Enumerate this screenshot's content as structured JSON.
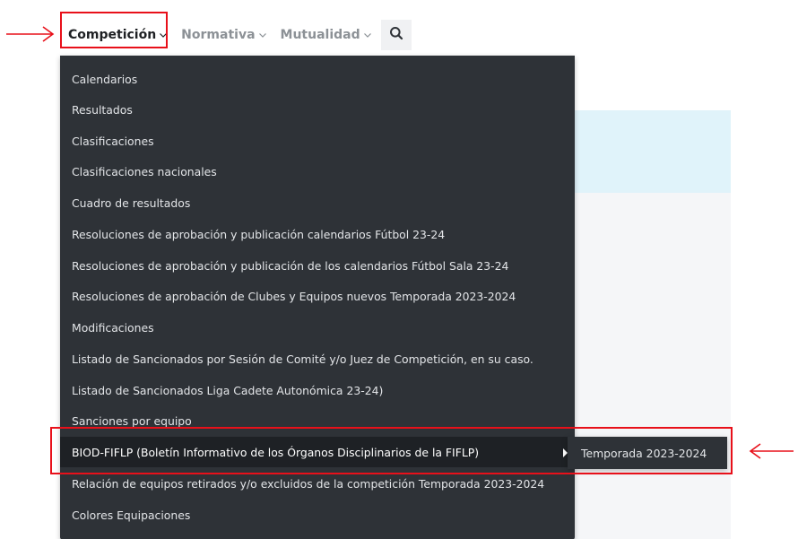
{
  "nav": {
    "items": [
      {
        "label": "Competición",
        "active": true
      },
      {
        "label": "Normativa",
        "active": false
      },
      {
        "label": "Mutualidad",
        "active": false
      }
    ],
    "search_icon": "search-icon"
  },
  "dropdown": {
    "items": [
      {
        "label": "Calendarios"
      },
      {
        "label": "Resultados"
      },
      {
        "label": "Clasificaciones"
      },
      {
        "label": "Clasificaciones nacionales"
      },
      {
        "label": "Cuadro de resultados"
      },
      {
        "label": "Resoluciones de aprobación y publicación calendarios Fútbol 23-24"
      },
      {
        "label": "Resoluciones de aprobación y publicación de los calendarios Fútbol Sala 23-24"
      },
      {
        "label": "Resoluciones de aprobación de Clubes y Equipos nuevos Temporada 2023-2024"
      },
      {
        "label": "Modificaciones"
      },
      {
        "label": "Listado de Sancionados por Sesión de Comité y/o Juez de Competición, en su caso."
      },
      {
        "label": "Listado de Sancionados Liga Cadete Autonómica 23-24)"
      },
      {
        "label": "Sanciones por equipo"
      },
      {
        "label": "BIOD-FIFLP (Boletín Informativo de los Órganos Disciplinarios de la FIFLP)",
        "has_submenu": true,
        "hover": true
      },
      {
        "label": "Relación de equipos retirados y/o excluidos de la competición Temporada 2023-2024"
      },
      {
        "label": "Colores Equipaciones"
      }
    ]
  },
  "submenu": {
    "items": [
      {
        "label": "Temporada 2023-2024"
      }
    ]
  },
  "colors": {
    "menu_bg": "#2e3237",
    "menu_hover": "#1e2125",
    "annotation_red": "#e8101a",
    "nav_active": "#1e2023",
    "nav_inactive": "#8c9196"
  }
}
